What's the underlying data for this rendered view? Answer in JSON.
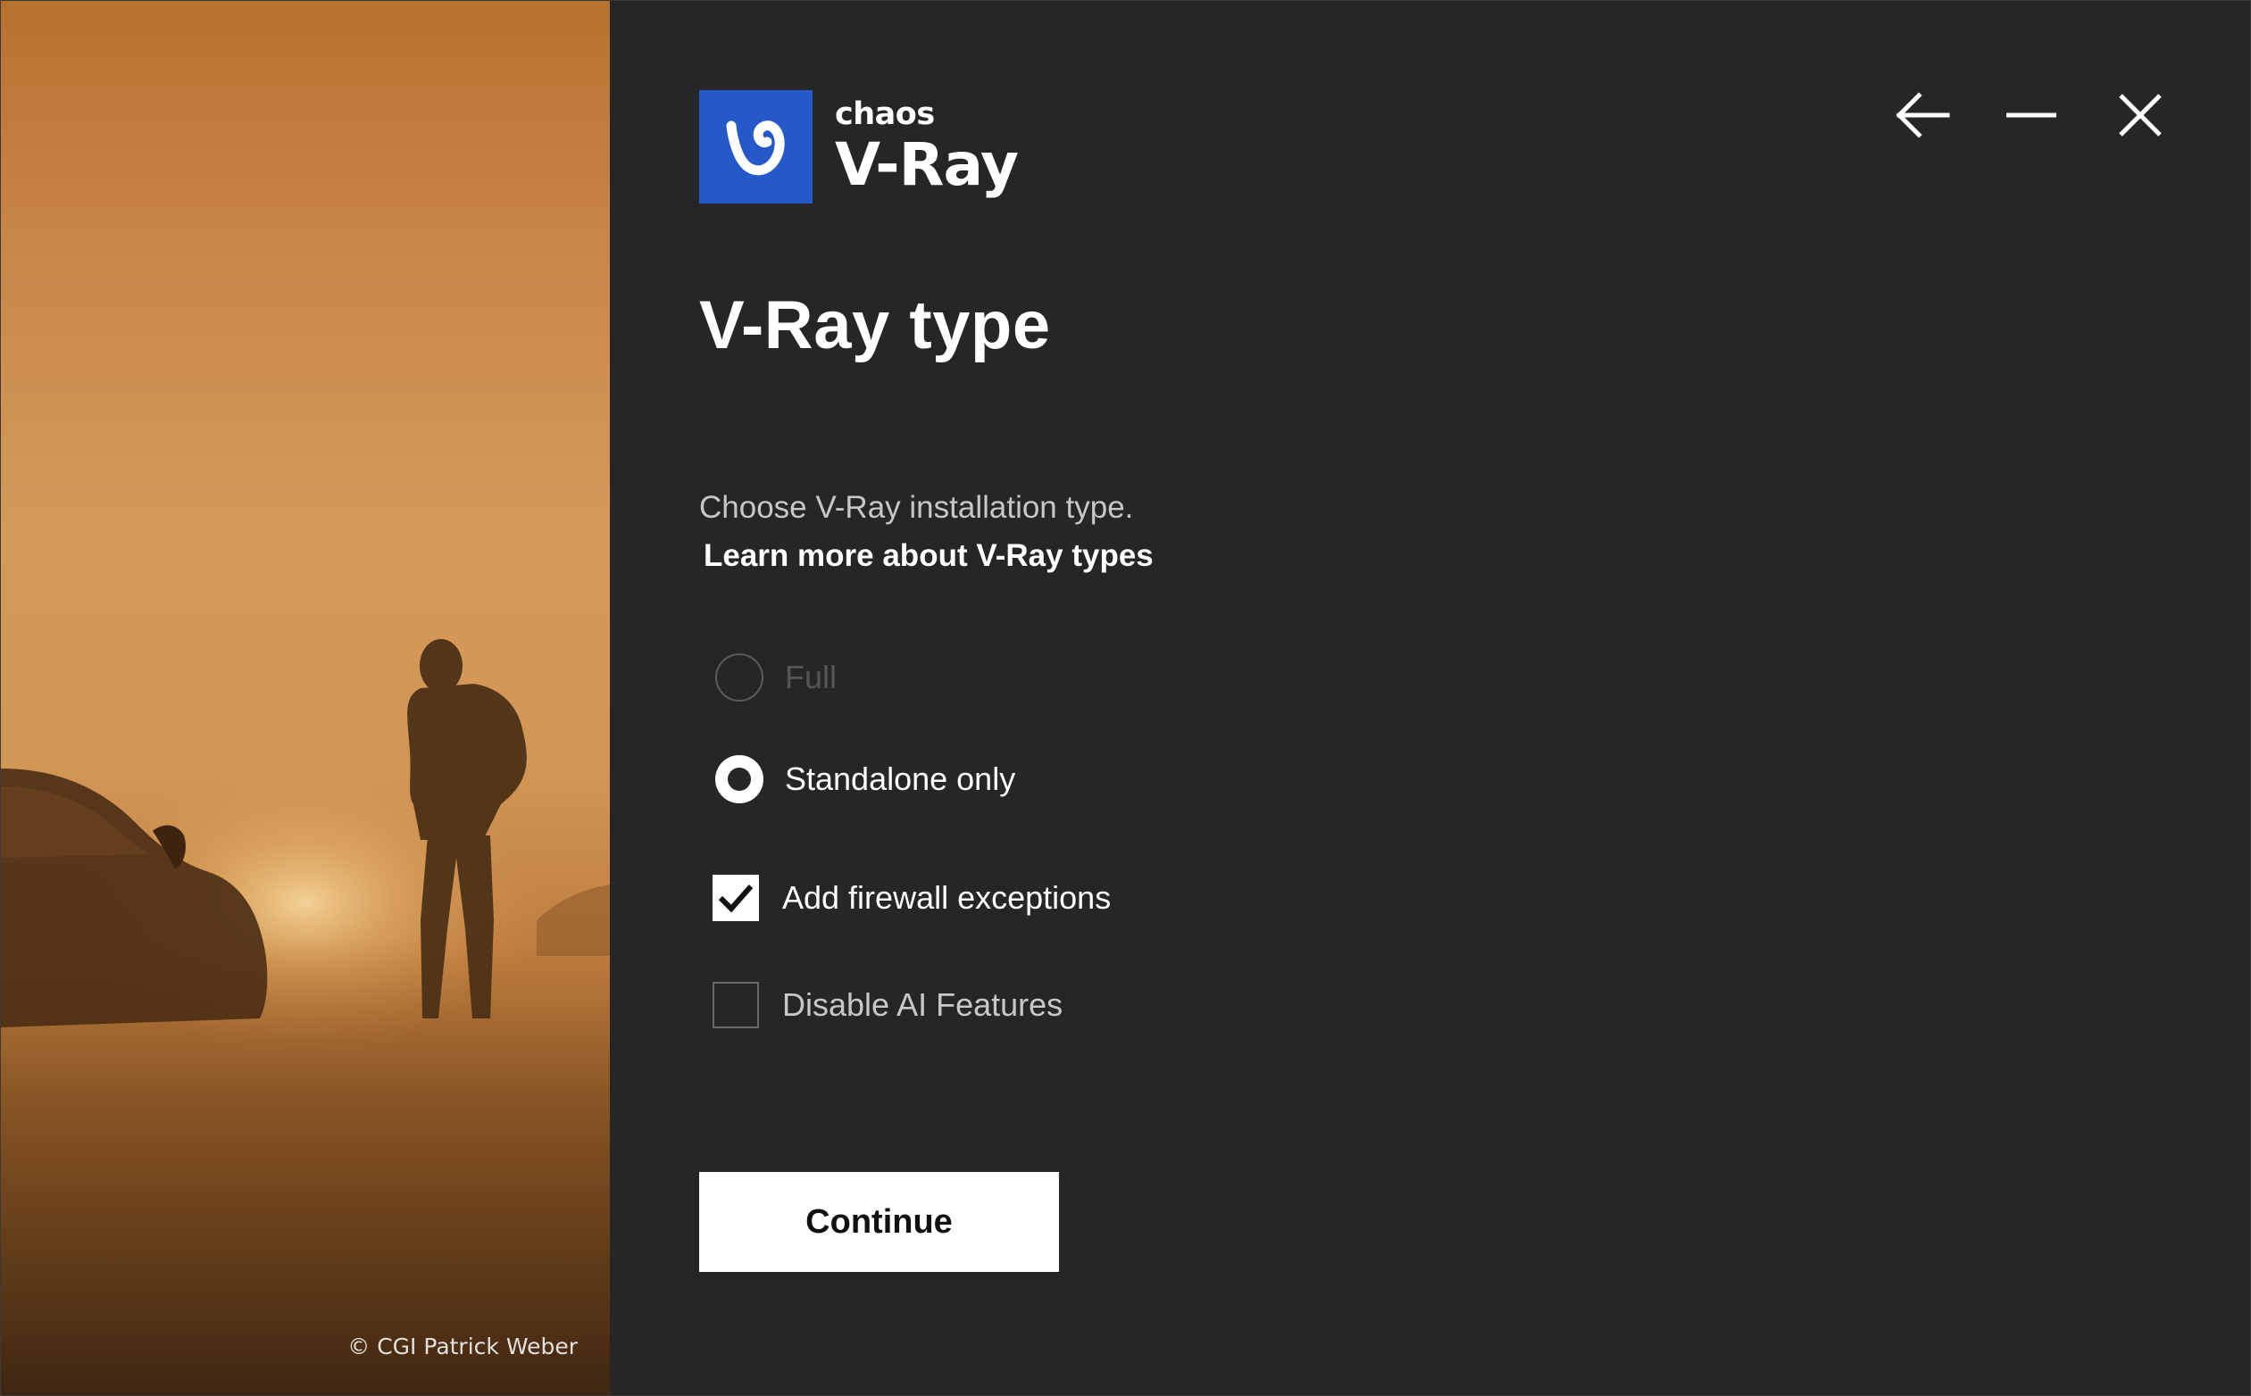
{
  "hero": {
    "credit": "© CGI Patrick Weber"
  },
  "brand": {
    "company": "chaos",
    "product": "V-Ray",
    "accent_color": "#2558c8"
  },
  "window_controls": {
    "back_icon": "arrow-left-icon",
    "minimize_icon": "minimize-icon",
    "close_icon": "close-icon"
  },
  "page": {
    "title": "V-Ray type",
    "subtitle": "Choose V-Ray installation type.",
    "learn_more": "Learn more about V-Ray types"
  },
  "options": {
    "radio": [
      {
        "label": "Full",
        "selected": false,
        "disabled": true
      },
      {
        "label": "Standalone only",
        "selected": true,
        "disabled": false
      }
    ],
    "checkboxes": [
      {
        "label": "Add firewall exceptions",
        "checked": true
      },
      {
        "label": "Disable AI Features",
        "checked": false
      }
    ]
  },
  "actions": {
    "continue_label": "Continue"
  }
}
